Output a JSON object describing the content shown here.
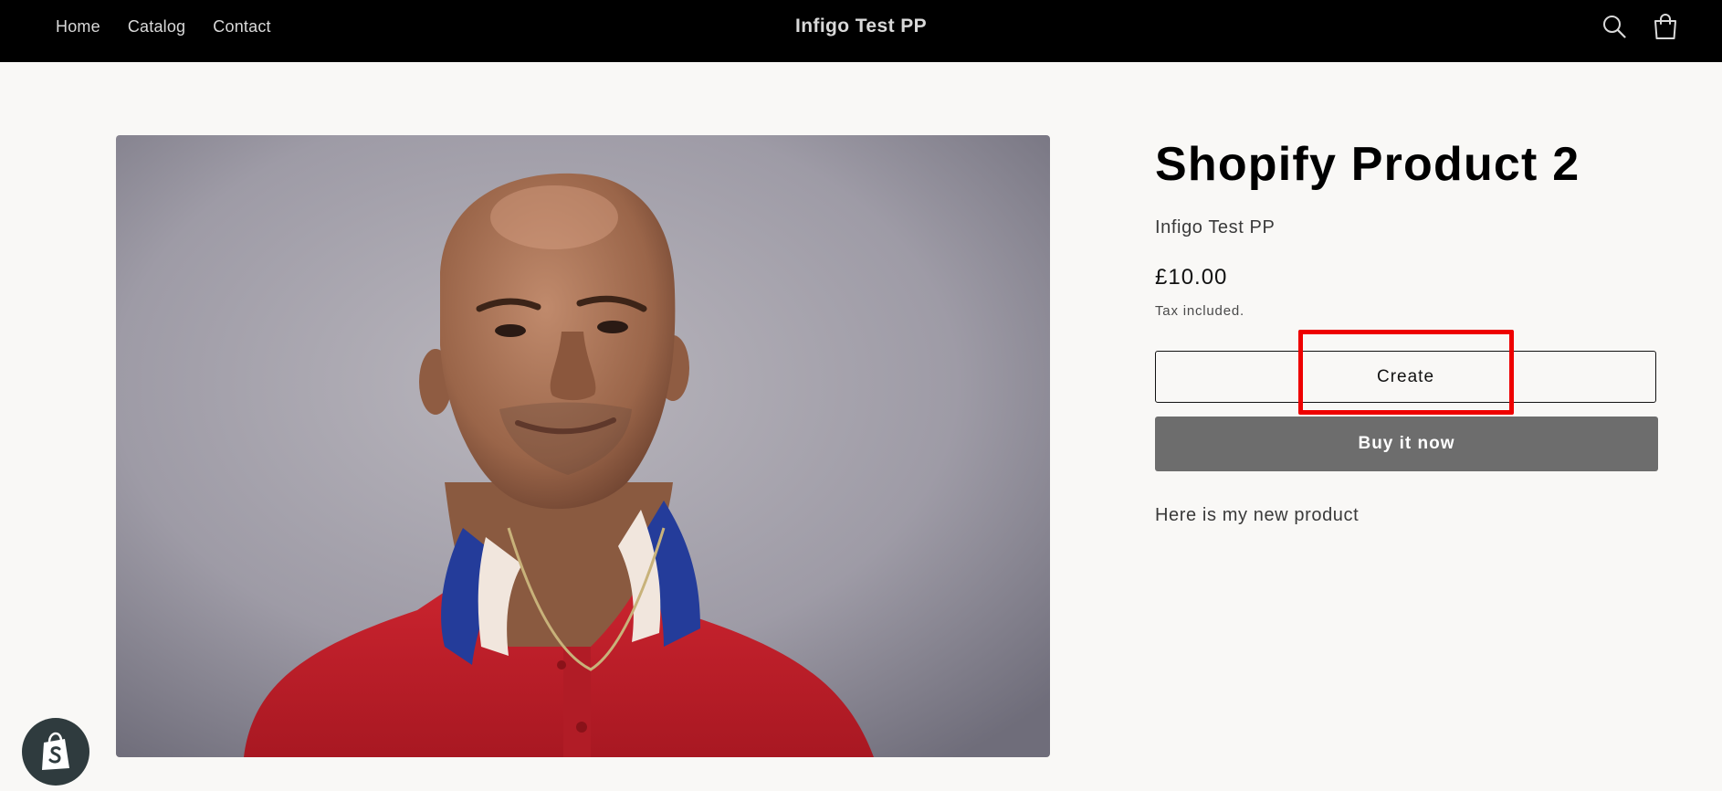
{
  "header": {
    "nav": [
      "Home",
      "Catalog",
      "Contact"
    ],
    "store_name": "Infigo Test PP",
    "icons": [
      "search-icon",
      "cart-icon"
    ]
  },
  "product": {
    "title": "Shopify Product 2",
    "vendor": "Infigo Test PP",
    "price": "£10.00",
    "tax_note": "Tax included.",
    "create_label": "Create",
    "buy_label": "Buy it now",
    "description": "Here is my new product"
  },
  "colors": {
    "header_bg": "#000000",
    "page_bg": "#f9f8f6",
    "buy_button": "#6d6d6d",
    "highlight": "#ee0000",
    "badge": "#2f3b3e"
  }
}
